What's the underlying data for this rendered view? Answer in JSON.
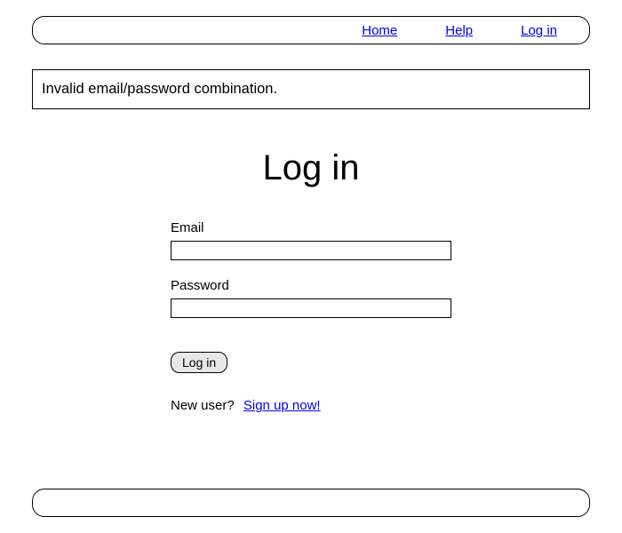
{
  "nav": {
    "home": "Home",
    "help": "Help",
    "login": "Log in"
  },
  "flash": {
    "message": "Invalid email/password combination."
  },
  "page": {
    "title": "Log in"
  },
  "form": {
    "email_label": "Email",
    "email_value": "",
    "password_label": "Password",
    "password_value": "",
    "submit_label": "Log in"
  },
  "signup": {
    "prompt": "New user?",
    "link": "Sign up now!"
  }
}
